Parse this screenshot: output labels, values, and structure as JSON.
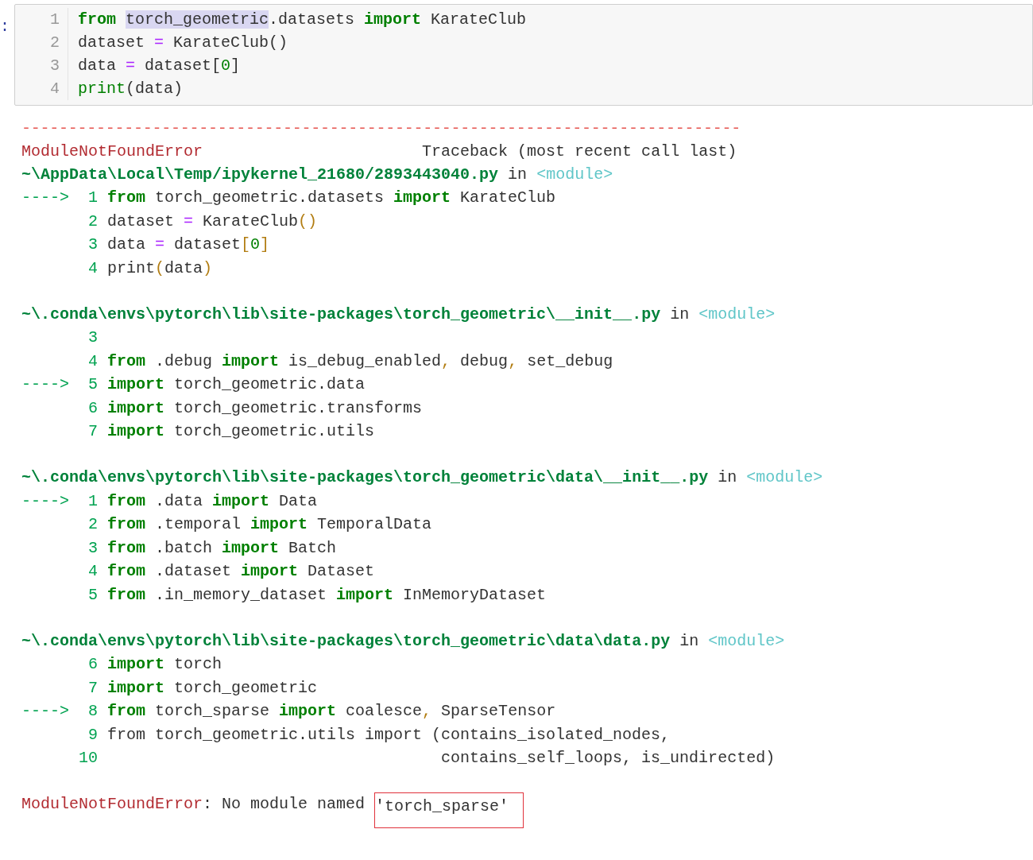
{
  "input_cell": {
    "prompt": ":",
    "lines": [
      {
        "number": "1",
        "segments": [
          {
            "text": "from ",
            "kind": "keyword"
          },
          {
            "text": "torch_geometric",
            "kind": "selection"
          },
          {
            "text": ".datasets ",
            "kind": "plain"
          },
          {
            "text": "import",
            "kind": "keyword"
          },
          {
            "text": " KarateClub",
            "kind": "plain"
          }
        ]
      },
      {
        "number": "2",
        "segments": [
          {
            "text": "dataset ",
            "kind": "plain"
          },
          {
            "text": "=",
            "kind": "operator"
          },
          {
            "text": " KarateClub()",
            "kind": "plain"
          }
        ]
      },
      {
        "number": "3",
        "segments": [
          {
            "text": "data ",
            "kind": "plain"
          },
          {
            "text": "=",
            "kind": "operator"
          },
          {
            "text": " dataset[",
            "kind": "plain"
          },
          {
            "text": "0",
            "kind": "number"
          },
          {
            "text": "]",
            "kind": "plain"
          }
        ]
      },
      {
        "number": "4",
        "segments": [
          {
            "text": "print",
            "kind": "builtin"
          },
          {
            "text": "(data)",
            "kind": "plain"
          }
        ]
      }
    ]
  },
  "output": {
    "rule": "-----------------------------------------------------------------------------",
    "header": {
      "error": "ModuleNotFoundError",
      "label": "Traceback (most recent call last)"
    },
    "frames": [
      {
        "path": [
          {
            "text": "~\\AppData\\Local\\Temp/ipykernel_21680/2893443040.py",
            "kind": "path"
          },
          {
            "text": " in ",
            "kind": "plain"
          },
          {
            "text": "<module>",
            "kind": "module"
          }
        ],
        "lines": [
          {
            "arrow": "---->",
            "number": "1",
            "segments": [
              {
                "text": "from",
                "kind": "keyword"
              },
              {
                "text": " torch_geometric.datasets ",
                "kind": "plain"
              },
              {
                "text": "import",
                "kind": "keyword"
              },
              {
                "text": " KarateClub",
                "kind": "plain"
              }
            ]
          },
          {
            "number": "2",
            "segments": [
              {
                "text": "dataset ",
                "kind": "plain"
              },
              {
                "text": "=",
                "kind": "operator"
              },
              {
                "text": " KarateClub",
                "kind": "plain"
              },
              {
                "text": "()",
                "kind": "punctuation"
              }
            ]
          },
          {
            "number": "3",
            "segments": [
              {
                "text": "data ",
                "kind": "plain"
              },
              {
                "text": "=",
                "kind": "operator"
              },
              {
                "text": " dataset",
                "kind": "plain"
              },
              {
                "text": "[",
                "kind": "punctuation"
              },
              {
                "text": "0",
                "kind": "number"
              },
              {
                "text": "]",
                "kind": "punctuation"
              }
            ]
          },
          {
            "number": "4",
            "segments": [
              {
                "text": "print",
                "kind": "plain"
              },
              {
                "text": "(",
                "kind": "punctuation"
              },
              {
                "text": "data",
                "kind": "plain"
              },
              {
                "text": ")",
                "kind": "punctuation"
              }
            ]
          }
        ]
      },
      {
        "path": [
          {
            "text": "~\\.conda\\envs\\pytorch\\lib\\site-packages\\torch_geometric\\__init__.py",
            "kind": "path"
          },
          {
            "text": " in ",
            "kind": "plain"
          },
          {
            "text": "<module>",
            "kind": "module"
          }
        ],
        "lines": [
          {
            "number": "3"
          },
          {
            "number": "4",
            "segments": [
              {
                "text": "from",
                "kind": "keyword"
              },
              {
                "text": " .debug ",
                "kind": "plain"
              },
              {
                "text": "import",
                "kind": "keyword"
              },
              {
                "text": " is_debug_enabled",
                "kind": "plain"
              },
              {
                "text": ",",
                "kind": "punctuation"
              },
              {
                "text": " debug",
                "kind": "plain"
              },
              {
                "text": ",",
                "kind": "punctuation"
              },
              {
                "text": " set_debug",
                "kind": "plain"
              }
            ]
          },
          {
            "arrow": "---->",
            "number": "5",
            "segments": [
              {
                "text": "import",
                "kind": "keyword"
              },
              {
                "text": " torch_geometric.data",
                "kind": "plain"
              }
            ]
          },
          {
            "number": "6",
            "segments": [
              {
                "text": "import",
                "kind": "keyword"
              },
              {
                "text": " torch_geometric.transforms",
                "kind": "plain"
              }
            ]
          },
          {
            "number": "7",
            "segments": [
              {
                "text": "import",
                "kind": "keyword"
              },
              {
                "text": " torch_geometric.utils",
                "kind": "plain"
              }
            ]
          }
        ]
      },
      {
        "path": [
          {
            "text": "~\\.conda\\envs\\pytorch\\lib\\site-packages\\torch_geometric\\data\\__init__.py",
            "kind": "path"
          },
          {
            "text": " in ",
            "kind": "plain"
          },
          {
            "text": "<module>",
            "kind": "module"
          }
        ],
        "lines": [
          {
            "arrow": "---->",
            "number": "1",
            "segments": [
              {
                "text": "from",
                "kind": "keyword"
              },
              {
                "text": " .data ",
                "kind": "plain"
              },
              {
                "text": "import",
                "kind": "keyword"
              },
              {
                "text": " Data",
                "kind": "plain"
              }
            ]
          },
          {
            "number": "2",
            "segments": [
              {
                "text": "from",
                "kind": "keyword"
              },
              {
                "text": " .temporal ",
                "kind": "plain"
              },
              {
                "text": "import",
                "kind": "keyword"
              },
              {
                "text": " TemporalData",
                "kind": "plain"
              }
            ]
          },
          {
            "number": "3",
            "segments": [
              {
                "text": "from",
                "kind": "keyword"
              },
              {
                "text": " .batch ",
                "kind": "plain"
              },
              {
                "text": "import",
                "kind": "keyword"
              },
              {
                "text": " Batch",
                "kind": "plain"
              }
            ]
          },
          {
            "number": "4",
            "segments": [
              {
                "text": "from",
                "kind": "keyword"
              },
              {
                "text": " .dataset ",
                "kind": "plain"
              },
              {
                "text": "import",
                "kind": "keyword"
              },
              {
                "text": " Dataset",
                "kind": "plain"
              }
            ]
          },
          {
            "number": "5",
            "segments": [
              {
                "text": "from",
                "kind": "keyword"
              },
              {
                "text": " .in_memory_dataset ",
                "kind": "plain"
              },
              {
                "text": "import",
                "kind": "keyword"
              },
              {
                "text": " InMemoryDataset",
                "kind": "plain"
              }
            ]
          }
        ]
      },
      {
        "path": [
          {
            "text": "~\\.conda\\envs\\pytorch\\lib\\site-packages\\torch_geometric\\data\\data.py",
            "kind": "path"
          },
          {
            "text": " in ",
            "kind": "plain"
          },
          {
            "text": "<module>",
            "kind": "module"
          }
        ],
        "lines": [
          {
            "number": "6",
            "segments": [
              {
                "text": "import",
                "kind": "keyword"
              },
              {
                "text": " torch",
                "kind": "plain"
              }
            ]
          },
          {
            "number": "7",
            "segments": [
              {
                "text": "import",
                "kind": "keyword"
              },
              {
                "text": " torch_geometric",
                "kind": "plain"
              }
            ]
          },
          {
            "arrow": "---->",
            "number": "8",
            "segments": [
              {
                "text": "from",
                "kind": "keyword"
              },
              {
                "text": " torch_sparse ",
                "kind": "plain"
              },
              {
                "text": "import",
                "kind": "keyword"
              },
              {
                "text": " coalesce",
                "kind": "plain"
              },
              {
                "text": ",",
                "kind": "punctuation"
              },
              {
                "text": " SparseTensor",
                "kind": "plain"
              }
            ]
          },
          {
            "number": "9",
            "segments": [
              {
                "text": "from torch_geometric.utils import (contains_isolated_nodes,",
                "kind": "plain"
              }
            ]
          },
          {
            "number": "10",
            "segments": [
              {
                "text": "                                   contains_self_loops, is_undirected)",
                "kind": "plain"
              }
            ]
          }
        ]
      }
    ],
    "error": {
      "name": "ModuleNotFoundError",
      "message": ": No module named ",
      "boxed": "'torch_sparse'"
    }
  }
}
